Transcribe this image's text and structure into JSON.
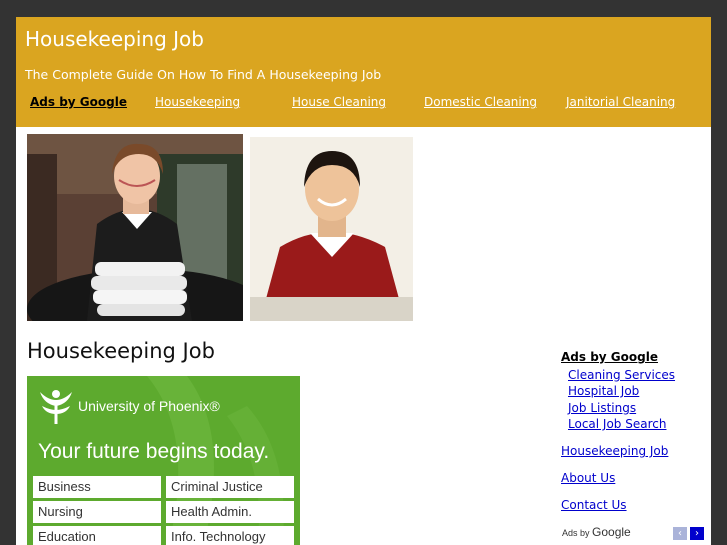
{
  "header": {
    "title": "Housekeeping Job",
    "tagline": "The Complete Guide On How To Find A Housekeeping Job"
  },
  "nav": {
    "ads_label": "Ads by Google",
    "items": [
      "Housekeeping",
      "House Cleaning",
      "Domestic Cleaning",
      "Janitorial Cleaning"
    ]
  },
  "main": {
    "post_title": "Housekeeping Job"
  },
  "banner": {
    "brand": "University of Phoenix®",
    "headline": "Your future begins today.",
    "programs": [
      "Business",
      "Criminal Justice",
      "Nursing",
      "Health Admin.",
      "Education",
      "Info. Technology"
    ]
  },
  "sidebar": {
    "ads_label": "Ads by Google",
    "ad_links": [
      "Cleaning Services",
      "Hospital Job",
      "Job Listings",
      "Local Job Search"
    ],
    "links": [
      "Housekeeping Job",
      "About Us",
      "Contact Us"
    ],
    "adsby_prefix": "Ads by",
    "adsby_brand": "Google",
    "prev_glyph": "‹",
    "next_glyph": "›"
  },
  "colors": {
    "page_bg": "#333333",
    "header_bg": "#daa520",
    "link": "#0000cc",
    "banner_green": "#5daa2e"
  }
}
